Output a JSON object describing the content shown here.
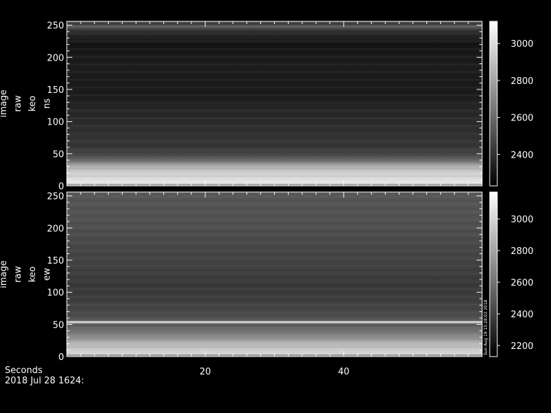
{
  "footer": {
    "seconds_label": "Seconds",
    "date_label": "2018 Jul 28 1624:"
  },
  "credit": "Sun Aug 19 15:28:02 2018",
  "chart_data": [
    {
      "type": "heatmap",
      "ylabel_lines": [
        "image",
        "raw",
        "keo",
        "ns"
      ],
      "x_range": [
        0,
        60
      ],
      "y_range": [
        0,
        256
      ],
      "x_ticks": [
        20,
        40
      ],
      "y_ticks": [
        0,
        50,
        100,
        150,
        200,
        250
      ],
      "colorbar_range": [
        2230,
        3120
      ],
      "colorbar_ticks": [
        2400,
        2600,
        2800,
        3000
      ],
      "row_profile": [
        {
          "y": 0,
          "v": 2600
        },
        {
          "y": 4,
          "v": 3050
        },
        {
          "y": 10,
          "v": 3000
        },
        {
          "y": 20,
          "v": 2950
        },
        {
          "y": 30,
          "v": 2850
        },
        {
          "y": 38,
          "v": 2650
        },
        {
          "y": 45,
          "v": 2500
        },
        {
          "y": 60,
          "v": 2420
        },
        {
          "y": 80,
          "v": 2400
        },
        {
          "y": 100,
          "v": 2380
        },
        {
          "y": 120,
          "v": 2360
        },
        {
          "y": 140,
          "v": 2330
        },
        {
          "y": 160,
          "v": 2320
        },
        {
          "y": 180,
          "v": 2330
        },
        {
          "y": 200,
          "v": 2320
        },
        {
          "y": 220,
          "v": 2300
        },
        {
          "y": 240,
          "v": 2380
        },
        {
          "y": 248,
          "v": 2560
        },
        {
          "y": 252,
          "v": 2420
        },
        {
          "y": 256,
          "v": 2560
        }
      ]
    },
    {
      "type": "heatmap",
      "ylabel_lines": [
        "image",
        "raw",
        "keo",
        "ew"
      ],
      "x_range": [
        0,
        60
      ],
      "y_range": [
        0,
        256
      ],
      "x_ticks": [
        20,
        40
      ],
      "y_ticks": [
        0,
        50,
        100,
        150,
        200,
        250
      ],
      "colorbar_range": [
        2130,
        3170
      ],
      "colorbar_ticks": [
        2200,
        2400,
        2600,
        2800,
        3000
      ],
      "row_profile": [
        {
          "y": 0,
          "v": 2550
        },
        {
          "y": 4,
          "v": 3000
        },
        {
          "y": 12,
          "v": 2950
        },
        {
          "y": 22,
          "v": 2850
        },
        {
          "y": 30,
          "v": 2700
        },
        {
          "y": 40,
          "v": 2600
        },
        {
          "y": 50,
          "v": 2480
        },
        {
          "y": 54,
          "v": 3100
        },
        {
          "y": 56,
          "v": 2480
        },
        {
          "y": 70,
          "v": 2420
        },
        {
          "y": 90,
          "v": 2380
        },
        {
          "y": 110,
          "v": 2360
        },
        {
          "y": 130,
          "v": 2380
        },
        {
          "y": 150,
          "v": 2400
        },
        {
          "y": 170,
          "v": 2420
        },
        {
          "y": 190,
          "v": 2440
        },
        {
          "y": 210,
          "v": 2460
        },
        {
          "y": 230,
          "v": 2470
        },
        {
          "y": 250,
          "v": 2480
        },
        {
          "y": 256,
          "v": 2500
        }
      ]
    }
  ]
}
